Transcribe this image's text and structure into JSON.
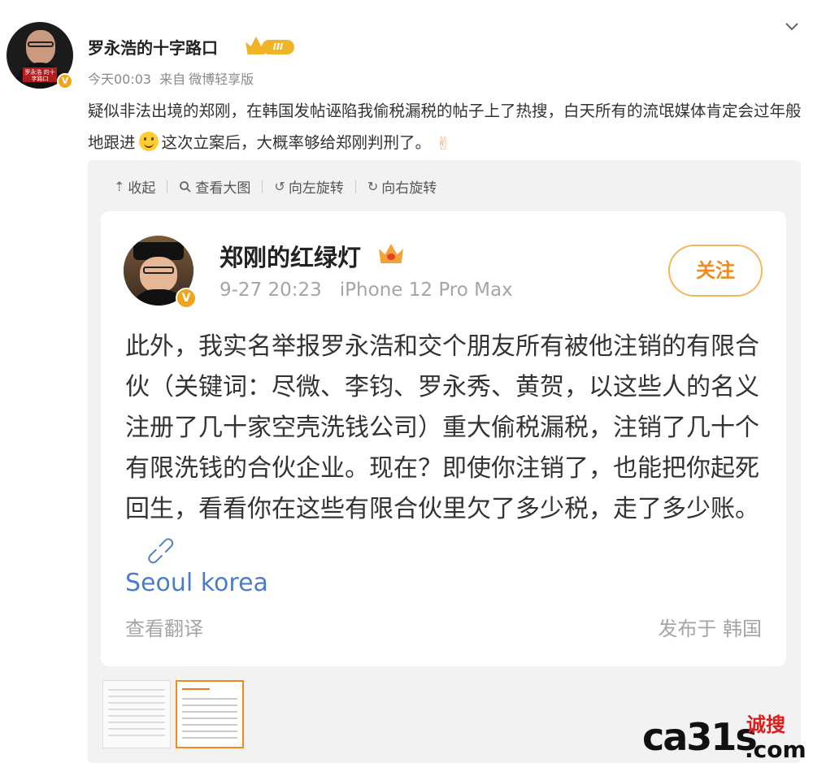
{
  "post": {
    "username": "罗永浩的十字路口",
    "member_level": "III",
    "avatar_caption": "罗永浩\n的十字路口",
    "time": "今天00:03",
    "source_prefix": "来自",
    "source": "微博轻享版",
    "text_part1": "疑似非法出境的郑刚，在韩国发帖诬陷我偷税漏税的帖子上了热搜，白天所有的流氓媒体肯定会过年般地跟进",
    "text_part2": "这次立案后，大概率够给郑刚判刑了。",
    "emoji_victory": "✌"
  },
  "toolbar": {
    "collapse": "收起",
    "view_large": "查看大图",
    "rotate_left": "向左旋转",
    "rotate_right": "向右旋转"
  },
  "screenshot_card": {
    "name": "郑刚的红绿灯",
    "time": "9-27 20:23",
    "device": "iPhone 12 Pro Max",
    "follow_label": "关注",
    "body": "此外，我实名举报罗永浩和交个朋友所有被他注销的有限合伙（关键词：尽微、李钧、罗永秀、黄贺，以这些人的名义注册了几十家空壳洗钱公司）重大偷税漏税，注销了几十个有限洗钱的合伙企业。现在？即使你注销了，也能把你起死回生，看看你在这些有限合伙里欠了多少税，走了多少账。",
    "location": "Seoul korea",
    "translate": "查看翻译",
    "published": "发布于 韩国"
  },
  "watermark": {
    "main": "ca31s",
    "com": ".com",
    "cn": "诚搜"
  },
  "colors": {
    "accent_orange": "#f08a1c",
    "link_blue": "#4c7ec7",
    "badge_gold": "#f0b428"
  }
}
